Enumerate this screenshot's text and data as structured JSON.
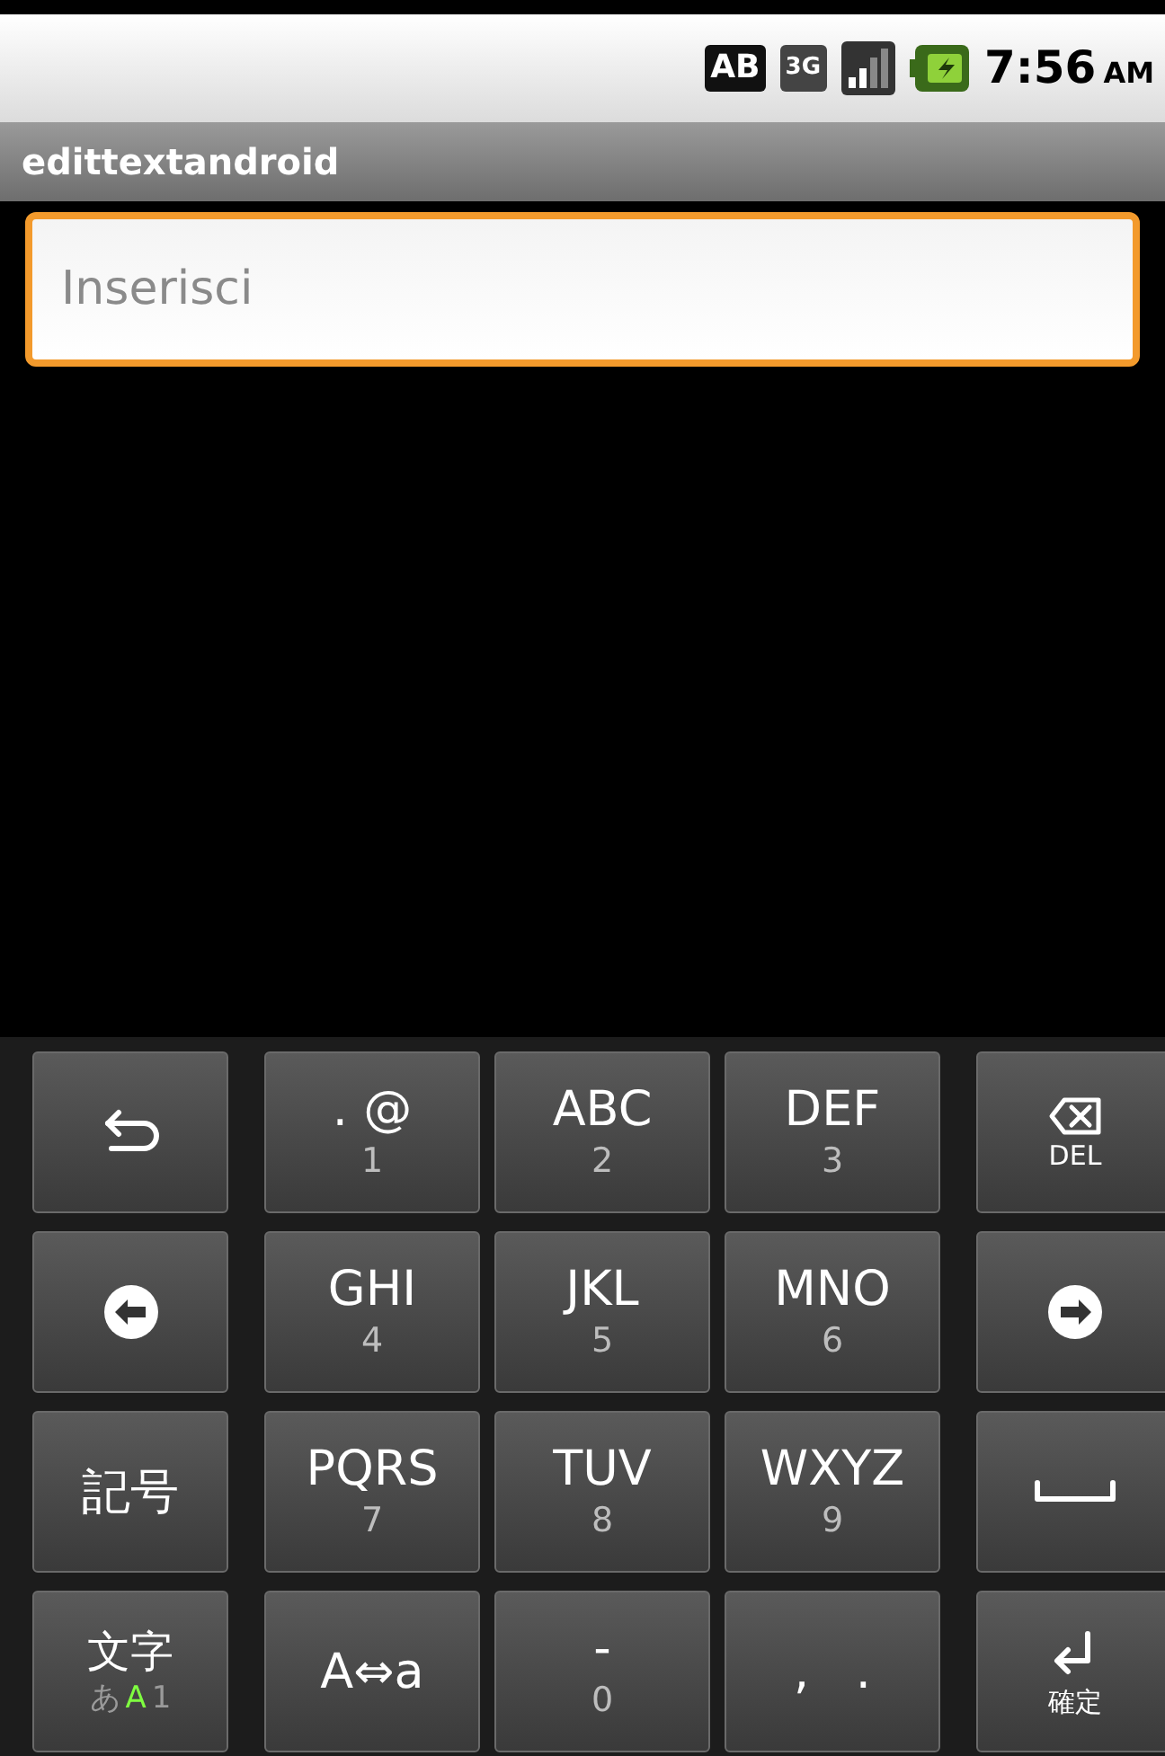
{
  "status_bar": {
    "badges": [
      "AB",
      "3G"
    ],
    "time": "7:56",
    "meridiem": "AM"
  },
  "title_bar": {
    "title": "edittextandroid"
  },
  "text_field": {
    "placeholder": "Inserisci"
  },
  "keyboard": {
    "rows": [
      [
        {
          "kind": "back"
        },
        {
          "kind": "keypad",
          "main": ". @",
          "sub": "1"
        },
        {
          "kind": "keypad",
          "main": "ABC",
          "sub": "2"
        },
        {
          "kind": "keypad",
          "main": "DEF",
          "sub": "3"
        },
        {
          "kind": "delete",
          "label": "DEL"
        }
      ],
      [
        {
          "kind": "left"
        },
        {
          "kind": "keypad",
          "main": "GHI",
          "sub": "4"
        },
        {
          "kind": "keypad",
          "main": "JKL",
          "sub": "5"
        },
        {
          "kind": "keypad",
          "main": "MNO",
          "sub": "6"
        },
        {
          "kind": "right"
        }
      ],
      [
        {
          "kind": "label",
          "main": "記号"
        },
        {
          "kind": "keypad",
          "main": "PQRS",
          "sub": "7"
        },
        {
          "kind": "keypad",
          "main": "TUV",
          "sub": "8"
        },
        {
          "kind": "keypad",
          "main": "WXYZ",
          "sub": "9"
        },
        {
          "kind": "space"
        }
      ],
      [
        {
          "kind": "mode",
          "main": "文字",
          "modes": [
            {
              "label": "あ",
              "selected": false
            },
            {
              "label": "A",
              "selected": true
            },
            {
              "label": "1",
              "selected": false
            }
          ]
        },
        {
          "kind": "label",
          "main": "A⇔a"
        },
        {
          "kind": "keypad",
          "main": "-",
          "sub": "0"
        },
        {
          "kind": "label",
          "main": ",   ."
        },
        {
          "kind": "enter",
          "label": "確定"
        }
      ]
    ]
  }
}
